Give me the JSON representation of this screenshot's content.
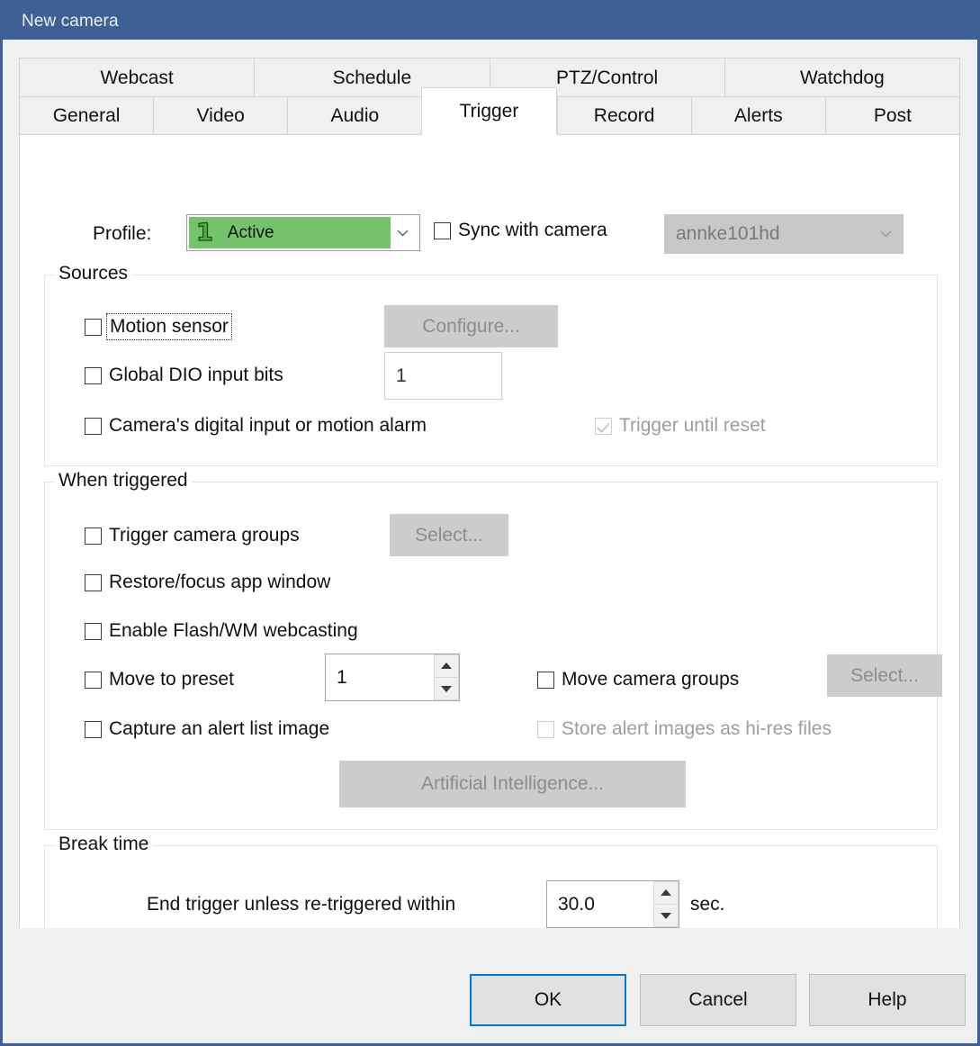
{
  "window": {
    "title": "New camera"
  },
  "tabs": {
    "row1": [
      {
        "label": "Webcast",
        "selected": false
      },
      {
        "label": "Schedule",
        "selected": false
      },
      {
        "label": "PTZ/Control",
        "selected": false
      },
      {
        "label": "Watchdog",
        "selected": false
      }
    ],
    "row2": [
      {
        "label": "General",
        "selected": false
      },
      {
        "label": "Video",
        "selected": false
      },
      {
        "label": "Audio",
        "selected": false
      },
      {
        "label": "Trigger",
        "selected": true
      },
      {
        "label": "Record",
        "selected": false
      },
      {
        "label": "Alerts",
        "selected": false
      },
      {
        "label": "Post",
        "selected": false
      }
    ]
  },
  "profile": {
    "label": "Profile:",
    "number": "1",
    "state": "Active",
    "fill_color": "#74c36a",
    "sync_label": "Sync with camera",
    "sync_checked": false,
    "camera_value": "annke101hd",
    "camera_disabled": true
  },
  "sources": {
    "title": "Sources",
    "motion_sensor": {
      "label": "Motion sensor",
      "checked": false,
      "focused": true
    },
    "configure_button": {
      "label": "Configure...",
      "disabled": true
    },
    "global_dio": {
      "label": "Global DIO input bits",
      "checked": false,
      "value": "1"
    },
    "camera_digital": {
      "label": "Camera's digital input or motion alarm",
      "checked": false
    },
    "trigger_until_reset": {
      "label": "Trigger until reset",
      "checked": true,
      "disabled": true
    }
  },
  "when_triggered": {
    "title": "When triggered",
    "trigger_camera_groups": {
      "label": "Trigger camera groups",
      "checked": false
    },
    "select_button_1": {
      "label": "Select...",
      "disabled": true
    },
    "restore_focus": {
      "label": "Restore/focus app window",
      "checked": false
    },
    "enable_flash": {
      "label": "Enable Flash/WM webcasting",
      "checked": false
    },
    "move_to_preset": {
      "label": "Move to preset",
      "checked": false,
      "value": "1"
    },
    "move_camera_groups": {
      "label": "Move camera groups",
      "checked": false
    },
    "select_button_2": {
      "label": "Select...",
      "disabled": true
    },
    "capture_alert_image": {
      "label": "Capture an alert list image",
      "checked": false
    },
    "store_hires": {
      "label": "Store alert images as hi-res files",
      "checked": false,
      "disabled": true
    },
    "ai_button": {
      "label": "Artificial Intelligence...",
      "disabled": true
    }
  },
  "break_time": {
    "title": "Break time",
    "label": "End trigger unless re-triggered within",
    "value": "30.0",
    "unit": "sec."
  },
  "footer": {
    "ok": "OK",
    "cancel": "Cancel",
    "help": "Help",
    "default_accent": "#0078d7"
  }
}
